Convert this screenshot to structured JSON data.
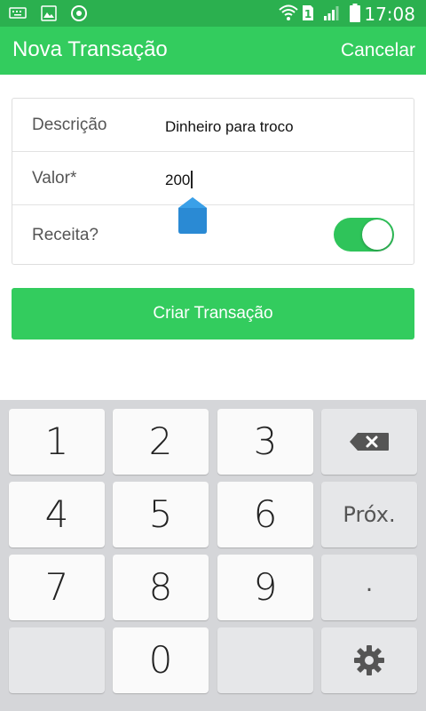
{
  "status_bar": {
    "time": "17:08",
    "icons": [
      "keyboard-icon",
      "image-icon",
      "chrome-icon",
      "wifi-icon",
      "sim-1-icon",
      "signal-icon",
      "battery-icon"
    ],
    "sim_label": "1",
    "color": "#2bb04f"
  },
  "app_bar": {
    "title": "Nova Transação",
    "cancel_label": "Cancelar",
    "color": "#33cc5e"
  },
  "form": {
    "descricao_label": "Descrição",
    "descricao_value": "Dinheiro para troco",
    "valor_label": "Valor*",
    "valor_value": "200",
    "receita_label": "Receita?",
    "receita_on": true
  },
  "submit_label": "Criar Transação",
  "keyboard": {
    "keys": [
      "1",
      "2",
      "3",
      "4",
      "5",
      "6",
      "7",
      "8",
      "9",
      "0"
    ],
    "next_label": "Próx.",
    "dot_label": ".",
    "backspace_icon": "backspace-icon",
    "settings_icon": "gear-icon"
  }
}
